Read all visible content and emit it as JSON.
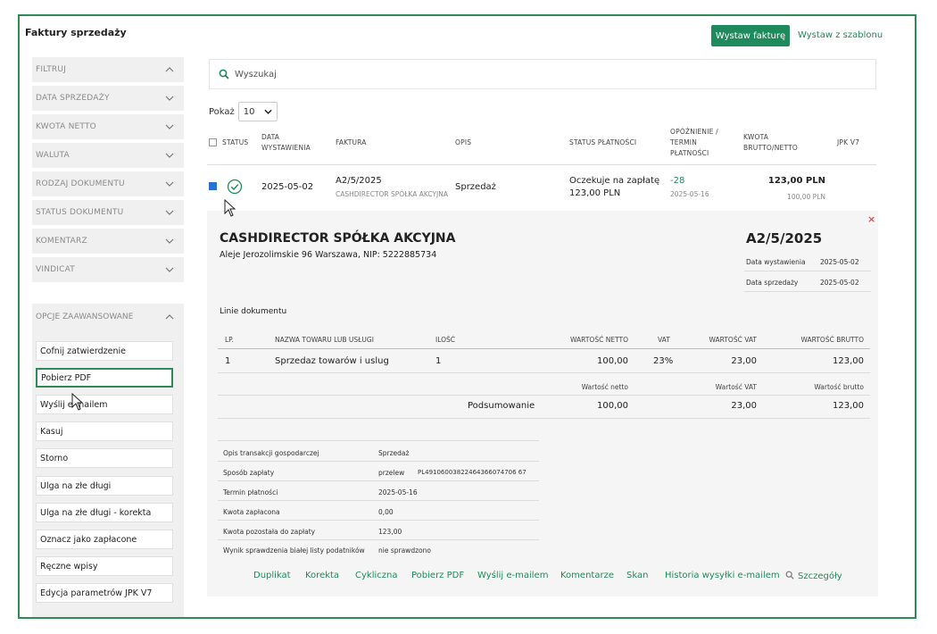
{
  "page": {
    "title": "Faktury sprzedaży",
    "issue_button": "Wystaw fakturę",
    "template_link": "Wystaw z szablonu"
  },
  "sidebar": {
    "filters_label": "FILTRUJ",
    "filters": [
      "DATA SPRZEDAŻY",
      "KWOTA NETTO",
      "WALUTA",
      "RODZAJ DOKUMENTU",
      "STATUS DOKUMENTU",
      "KOMENTARZ",
      "VINDICAT"
    ],
    "advanced_label": "OPCJE ZAAWANSOWANE",
    "advanced_options": [
      "Cofnij zatwierdzenie",
      "Pobierz PDF",
      "Wyślij e-mailem",
      "Kasuj",
      "Storno",
      "Ulga na złe długi",
      "Ulga na złe długi - korekta",
      "Oznacz jako zapłacone",
      "Ręczne wpisy",
      "Edycja parametrów JPK V7"
    ],
    "active_option_index": 1
  },
  "search": {
    "placeholder": "Wyszukaj"
  },
  "pagination": {
    "show_label": "Pokaż",
    "page_size": "10"
  },
  "table": {
    "headers": {
      "status": "STATUS",
      "date_l1": "DATA",
      "date_l2": "WYSTAWIENIA",
      "invoice": "FAKTURA",
      "desc": "OPIS",
      "payment_status": "STATUS PŁATNOŚCI",
      "delay_l1": "OPÓŹNIENIE /",
      "delay_l2": "TERMIN",
      "delay_l3": "PŁATNOŚCI",
      "amount_l1": "KWOTA",
      "amount_l2": "BRUTTO/NETTO",
      "jpk": "JPK V7"
    },
    "row": {
      "date": "2025-05-02",
      "number": "A2/5/2025",
      "client": "CASHDIRECTOR SPÓŁKA AKCYJNA",
      "desc": "Sprzedaż",
      "payment_status": "Oczekuje na zapłatę",
      "payment_amount": "123,00 PLN",
      "delay": "-28",
      "due_date": "2025-05-16",
      "gross": "123,00 PLN",
      "net": "100,00 PLN"
    }
  },
  "detail": {
    "company": "CASHDIRECTOR SPÓŁKA AKCYJNA",
    "address": "Aleje Jerozolimskie 96 Warszawa, NIP: 5222885734",
    "invoice_no": "A2/5/2025",
    "issue_date_label": "Data wystawienia",
    "issue_date": "2025-05-02",
    "sale_date_label": "Data sprzedaży",
    "sale_date": "2025-05-02",
    "lines_title": "Linie dokumentu",
    "line_headers": {
      "lp": "LP.",
      "name": "NAZWA TOWARU LUB USŁUGI",
      "qty": "ILOŚĆ",
      "net": "WARTOŚĆ NETTO",
      "vat": "VAT",
      "vat_value": "WARTOŚĆ VAT",
      "gross": "WARTOŚĆ BRUTTO"
    },
    "line": {
      "lp": "1",
      "name": "Sprzedaz towarów i uslug",
      "qty": "1",
      "net": "100,00",
      "vat": "23%",
      "vat_value": "23,00",
      "gross": "123,00"
    },
    "summary_headers": {
      "net": "Wartość netto",
      "vat": "Wartość VAT",
      "gross": "Wartość brutto"
    },
    "summary": {
      "label": "Podsumowanie",
      "net": "100,00",
      "vat": "23,00",
      "gross": "123,00"
    },
    "info": [
      {
        "label": "Opis transakcji gospodarczej",
        "value": "Sprzedaż"
      },
      {
        "label": "Sposób zapłaty",
        "value": "przelew",
        "extra": "PL49106003822464366074706 67"
      },
      {
        "label": "Termin płatności",
        "value": "2025-05-16"
      },
      {
        "label": "Kwota zapłacona",
        "value": "0,00"
      },
      {
        "label": "Kwota pozostała do zapłaty",
        "value": "123,00"
      },
      {
        "label": "Wynik sprawdzenia białej listy podatników",
        "value": "nie sprawdzono"
      }
    ],
    "actions": [
      "Duplikat",
      "Korekta",
      "Cykliczna",
      "Pobierz PDF",
      "Wyślij e-mailem",
      "Komentarze",
      "Skan",
      "Historia wysyłki e-mailem",
      "Szczegóły"
    ]
  },
  "colors": {
    "accent": "#1f8a5b",
    "frame": "#2e8b57",
    "close": "#d9534f"
  }
}
